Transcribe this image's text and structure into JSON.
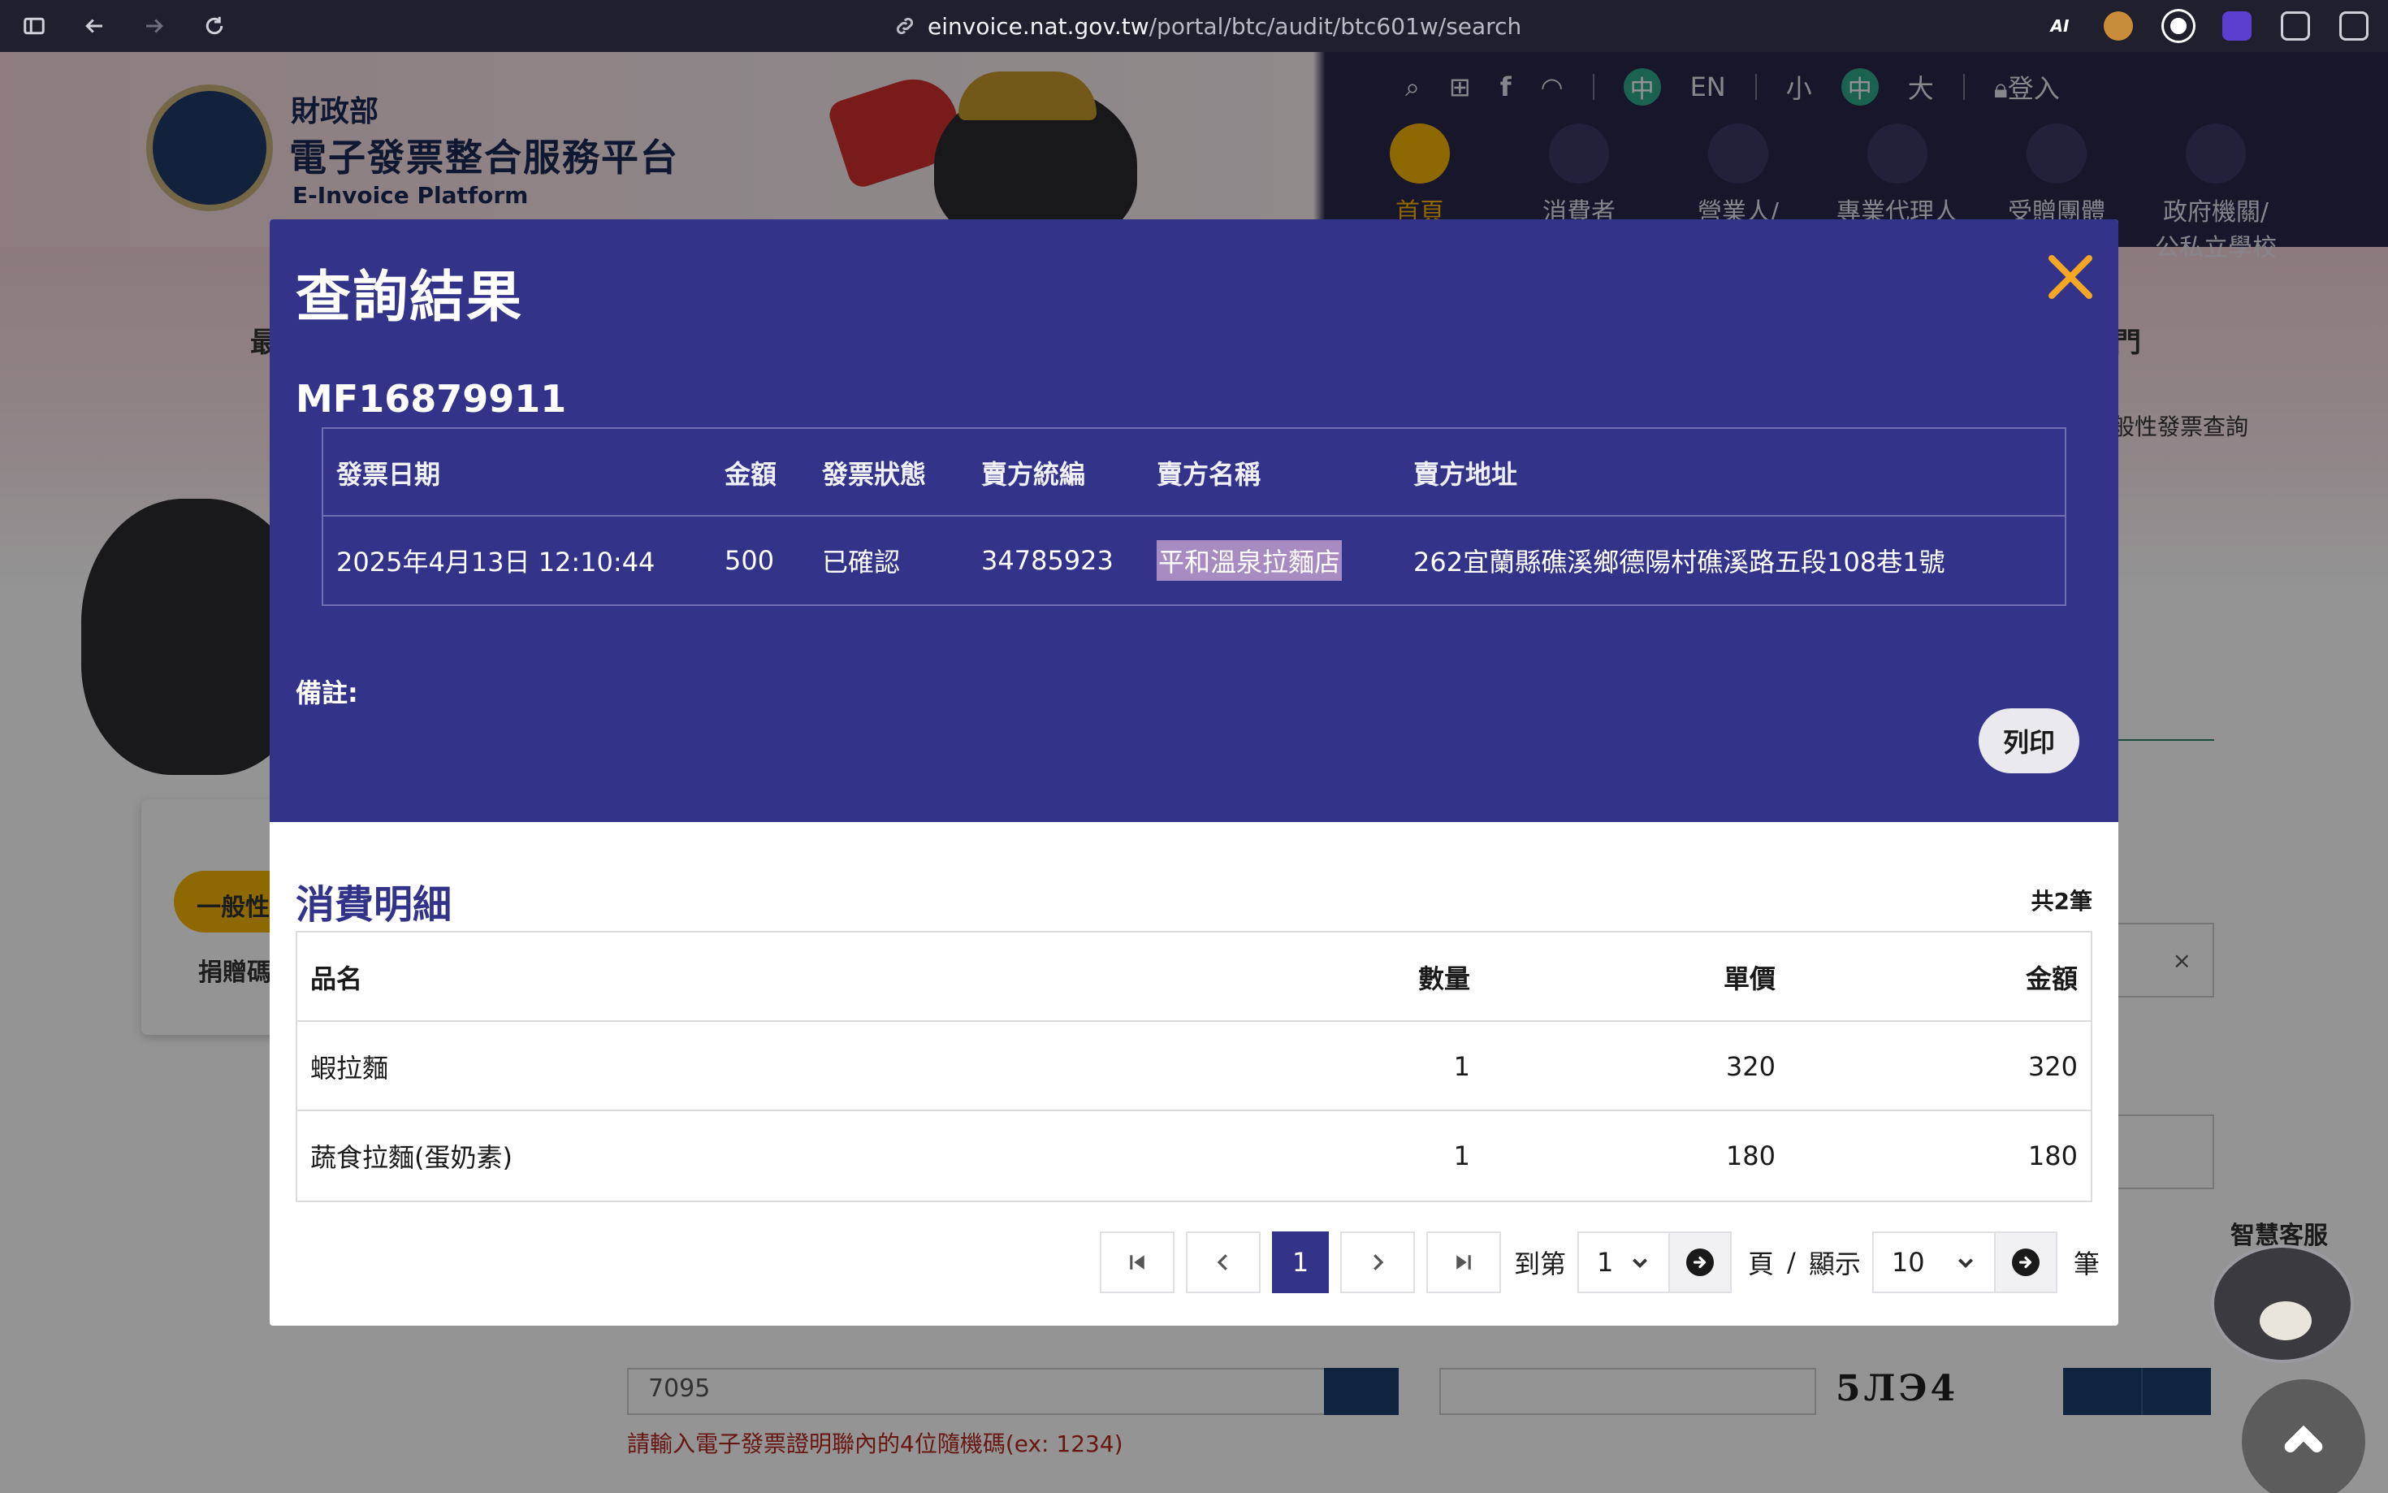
{
  "browser": {
    "url_host": "einvoice.nat.gov.tw",
    "url_path": "/portal/btc/audit/btc601w/search"
  },
  "site": {
    "ministry": "財政部",
    "platform_name": "電子發票整合服務平台",
    "platform_name_en": "E-Invoice Platform",
    "lang_zh": "中",
    "lang_en": "EN",
    "size_small": "小",
    "size_mid": "中",
    "size_large": "大",
    "login": "登入",
    "nav": [
      {
        "label": "首頁"
      },
      {
        "label": "消費者"
      },
      {
        "label": "營業人/"
      },
      {
        "label": "專業代理人"
      },
      {
        "label": "受贈團體"
      },
      {
        "label": "政府機關/\n公私立學校"
      }
    ],
    "left_heading": "最",
    "right_heading": "門",
    "right_crumb": "般性發票查詢",
    "tab_general": "一般性",
    "donation_code": "捐贈碼",
    "random_code_value": "7095",
    "random_code_hint": "請輸入電子發票證明聯內的4位隨機碼(ex: 1234)",
    "captcha_text": "5ЛЭ4",
    "clear_x": "×",
    "smart_service": "智慧客服"
  },
  "modal": {
    "title": "查詢結果",
    "invoice_number": "MF16879911",
    "invoice_table": {
      "headers": [
        "發票日期",
        "金額",
        "發票狀態",
        "賣方統編",
        "賣方名稱",
        "賣方地址"
      ],
      "rows": [
        [
          "2025年4月13日 12:10:44",
          "500",
          "已確認",
          "34785923",
          "平和溫泉拉麵店",
          "262宜蘭縣礁溪鄉德陽村礁溪路五段108巷1號"
        ]
      ]
    },
    "remark_label": "備註:",
    "print_label": "列印",
    "detail_title": "消費明細",
    "detail_count": "共2筆",
    "detail_table": {
      "headers": [
        "品名",
        "數量",
        "單價",
        "金額"
      ],
      "rows": [
        [
          "蝦拉麵",
          "1",
          "320",
          "320"
        ],
        [
          "蔬食拉麵(蛋奶素)",
          "1",
          "180",
          "180"
        ]
      ]
    },
    "pagination": {
      "current_page": "1",
      "goto_label": "到第",
      "page_select": "1",
      "page_unit": "頁",
      "separator": "/",
      "show_label": "顯示",
      "page_size": "10",
      "items_unit": "筆"
    }
  },
  "colors": {
    "modal_header": "#33338a",
    "close_icon": "#f5a623",
    "highlight": "#a88bc0"
  }
}
